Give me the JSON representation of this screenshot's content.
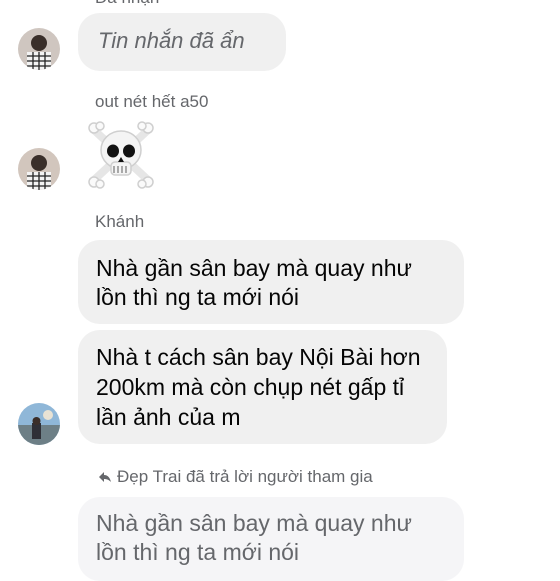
{
  "top_fragment": "Đã nhận",
  "messages": [
    {
      "sender": "",
      "text": "Tin nhắn đã ẩn",
      "hidden": true
    },
    {
      "sender": "out nét hết a50",
      "emoji": "☠"
    },
    {
      "sender": "Khánh",
      "text": "Nhà gần sân bay mà quay như lồn thì ng ta mới nói"
    },
    {
      "sender": "",
      "text": "Nhà t cách sân bay Nội Bài hơn 200km mà còn chụp nét gấp tỉ lần ảnh của m"
    }
  ],
  "reply": {
    "label": "Đẹp Trai đã trả lời người tham gia",
    "quoted": "Nhà gần sân bay mà quay như lồn thì ng ta mới nói"
  },
  "colors": {
    "bubble": "#f0f0f0",
    "quoted_bubble": "#f5f5f7",
    "secondary_text": "#65676b"
  }
}
